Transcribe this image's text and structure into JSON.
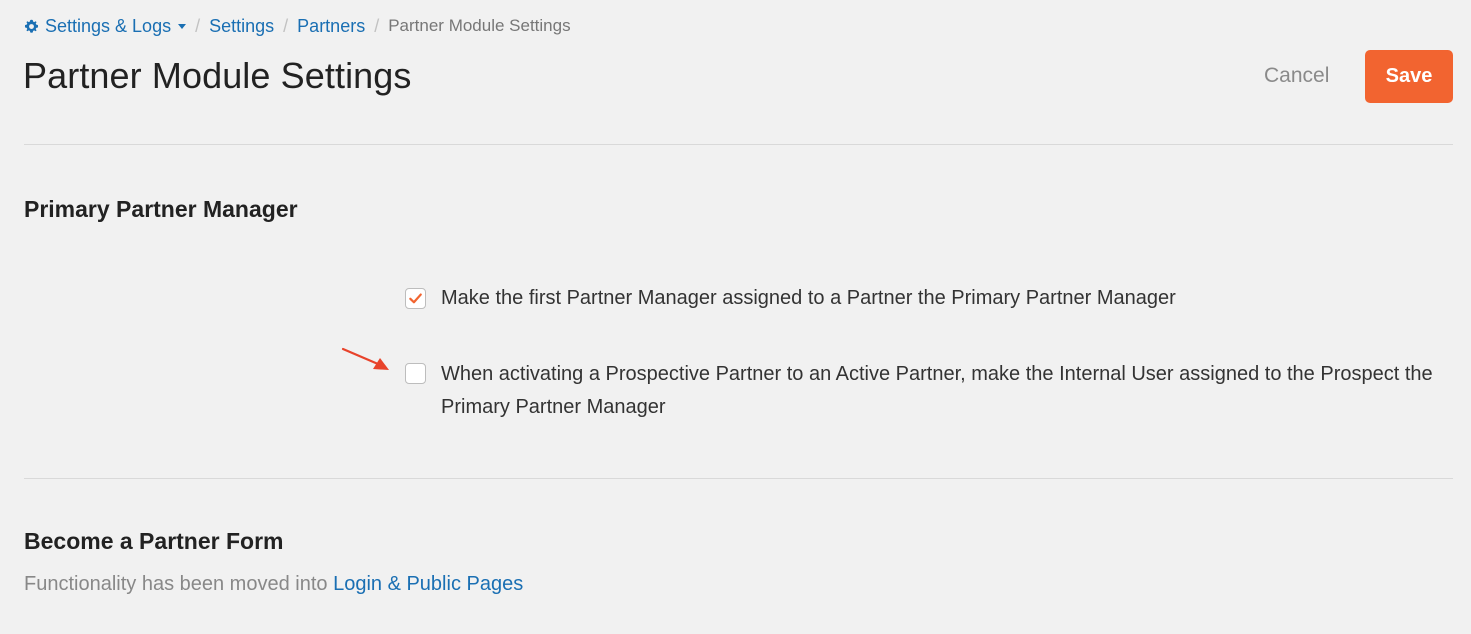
{
  "breadcrumb": {
    "settings_logs": "Settings & Logs",
    "settings": "Settings",
    "partners": "Partners",
    "current": "Partner Module Settings",
    "separator": "/"
  },
  "page": {
    "title": "Partner Module Settings"
  },
  "actions": {
    "cancel_label": "Cancel",
    "save_label": "Save"
  },
  "primary_partner_manager": {
    "heading": "Primary Partner Manager",
    "options": [
      {
        "label": "Make the first Partner Manager assigned to a Partner the Primary Partner Manager",
        "checked": true
      },
      {
        "label": "When activating a Prospective Partner to an Active Partner, make the Internal User assigned to the Prospect the Primary Partner Manager",
        "checked": false
      }
    ]
  },
  "become_partner_form": {
    "heading": "Become a Partner Form",
    "text": "Functionality has been moved into ",
    "link": "Login & Public Pages"
  },
  "icons": {
    "settings": "gear-icon",
    "dropdown": "caret-down-icon",
    "checked": "checkmark-icon",
    "annotation": "red-arrow"
  },
  "colors": {
    "accent": "#f26430",
    "link": "#1a6fb3",
    "background": "#f1f1f1",
    "annotation_arrow": "#e8432b"
  }
}
